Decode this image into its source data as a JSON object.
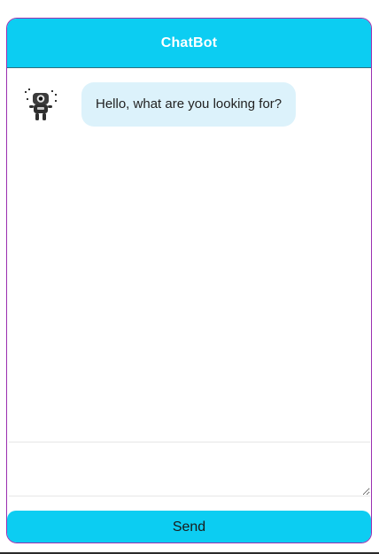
{
  "header": {
    "title": "ChatBot",
    "color": "#0ccdf2"
  },
  "messages": [
    {
      "sender": "bot",
      "avatar_icon": "robot-icon",
      "text": "Hello, what are you looking for?",
      "bubble_color": "#dcf2fb"
    }
  ],
  "composer": {
    "placeholder": "",
    "value": ""
  },
  "send": {
    "label": "Send",
    "color": "#0ccdf2"
  }
}
